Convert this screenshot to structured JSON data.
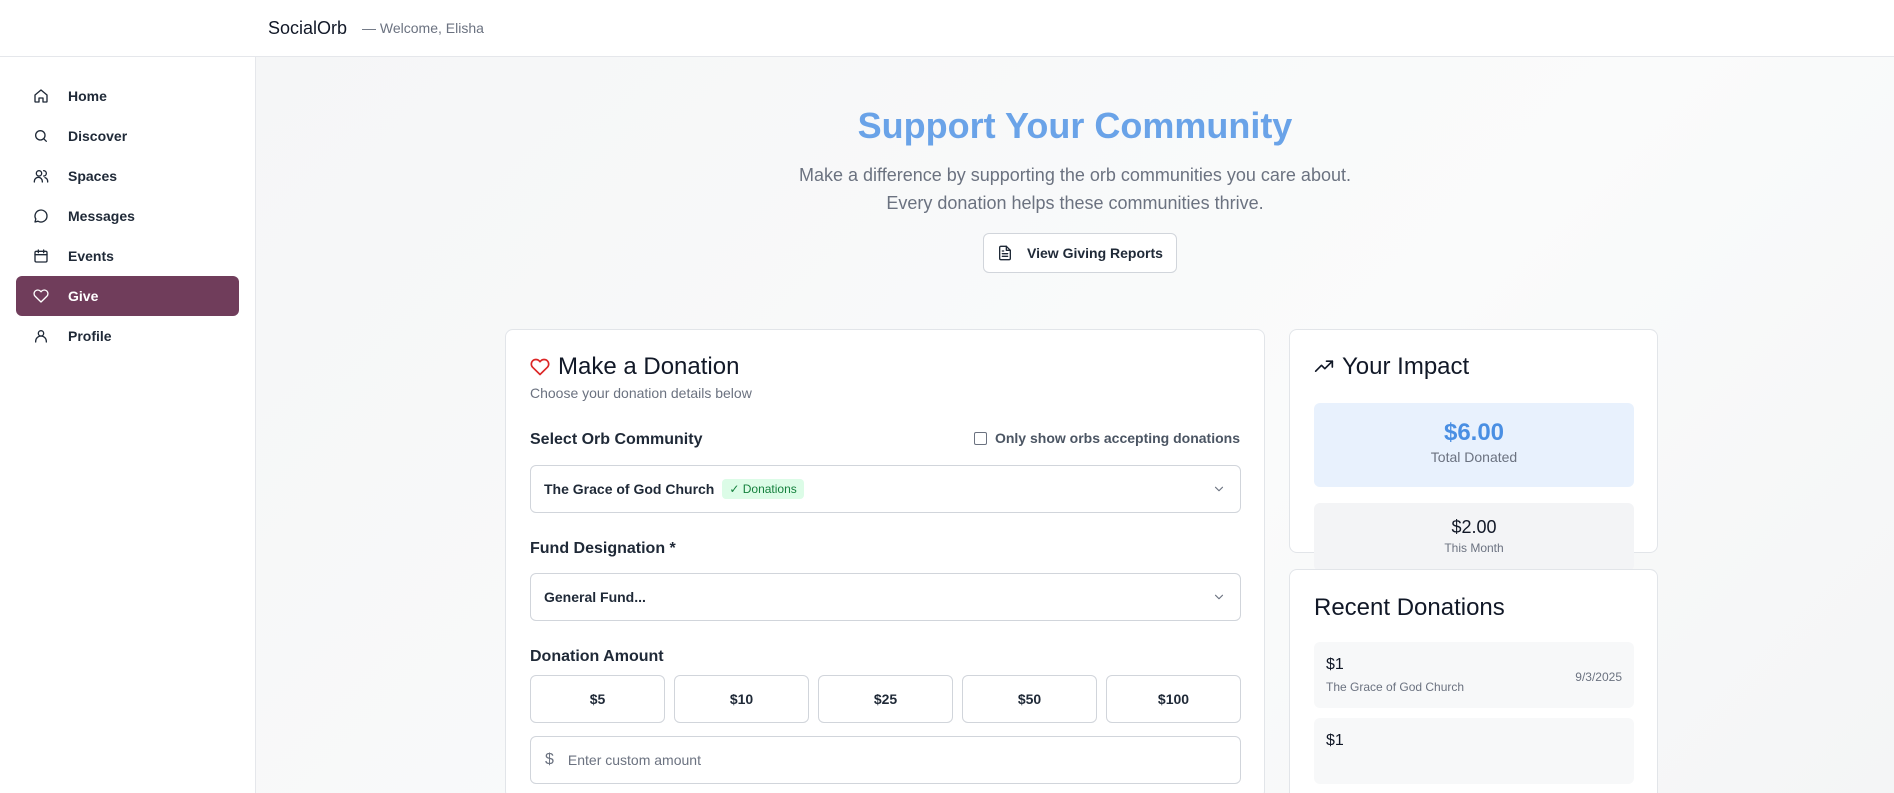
{
  "header": {
    "brand": "SocialOrb",
    "welcome": "— Welcome, Elisha"
  },
  "sidebar": {
    "items": [
      {
        "label": "Home",
        "icon": "home-icon"
      },
      {
        "label": "Discover",
        "icon": "search-icon"
      },
      {
        "label": "Spaces",
        "icon": "users-icon"
      },
      {
        "label": "Messages",
        "icon": "message-circle-icon"
      },
      {
        "label": "Events",
        "icon": "calendar-icon"
      },
      {
        "label": "Give",
        "icon": "heart-icon",
        "active": true
      },
      {
        "label": "Profile",
        "icon": "user-icon"
      }
    ]
  },
  "hero": {
    "title": "Support Your Community",
    "subtitle": "Make a difference by supporting the orb communities you care about. Every donation helps these communities thrive.",
    "reports_button": "View Giving Reports"
  },
  "donation_form": {
    "title": "Make a Donation",
    "description": "Choose your donation details below",
    "community_label": "Select Orb Community",
    "filter_label": "Only show orbs accepting donations",
    "filter_checked": false,
    "selected_community": "The Grace of God Church",
    "community_badge": "✓ Donations",
    "fund_label": "Fund Designation *",
    "fund_value": "General Fund...",
    "amount_label": "Donation Amount",
    "preset_amounts": [
      "$5",
      "$10",
      "$25",
      "$50",
      "$100"
    ],
    "currency_symbol": "$",
    "custom_placeholder": "Enter custom amount"
  },
  "impact": {
    "title": "Your Impact",
    "total_value": "$6.00",
    "total_label": "Total Donated",
    "month_value": "$2.00",
    "month_label": "This Month"
  },
  "recent": {
    "title": "Recent Donations",
    "items": [
      {
        "amount": "$1",
        "org": "The Grace of God Church",
        "date": "9/3/2025"
      },
      {
        "amount": "$1",
        "org": "",
        "date": ""
      }
    ]
  },
  "colors": {
    "accent_active": "#703d5b",
    "hero_title": "#6aa3e8",
    "total_value": "#4a8fe3",
    "heart": "#dc2626",
    "badge_bg": "#dcfce7",
    "badge_text": "#15803d"
  }
}
